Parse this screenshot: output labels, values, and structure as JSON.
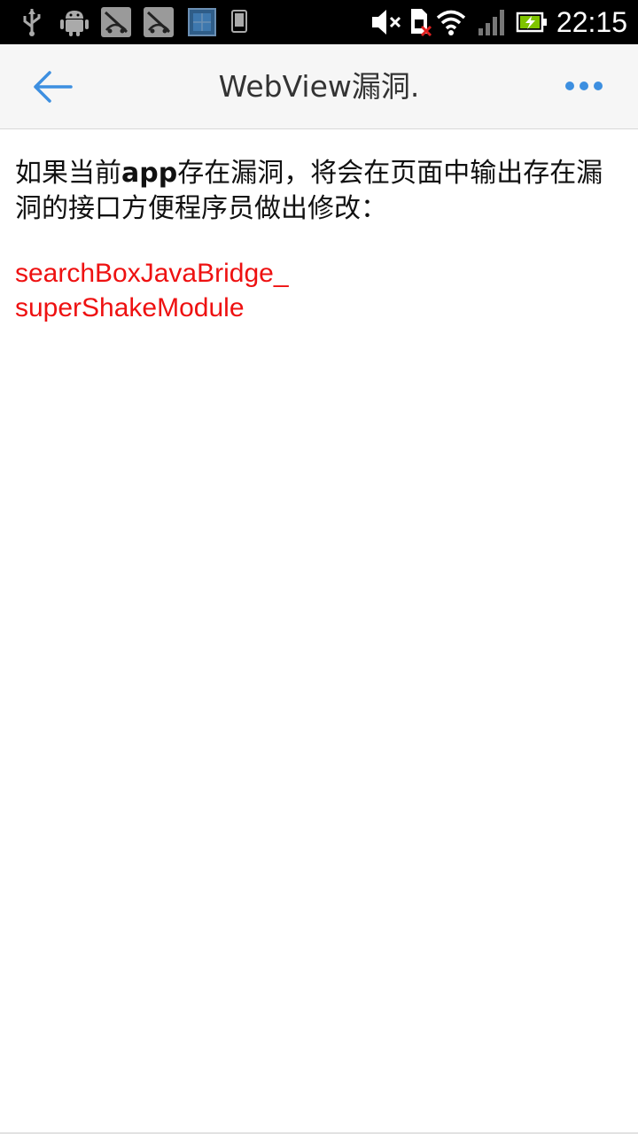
{
  "status_bar": {
    "time": "22:15",
    "icons": [
      "usb-icon",
      "android-debug-icon",
      "app-notification-icon",
      "app-notification-icon",
      "gallery-notification-icon",
      "phone-notification-icon",
      "mute-icon",
      "sim-error-icon",
      "wifi-icon",
      "signal-icon",
      "battery-charging-icon"
    ]
  },
  "title_bar": {
    "back_icon": "arrow-left-icon",
    "title": "WebView漏洞.",
    "more_icon": "more-dots-icon",
    "accent_color": "#3d8fe0"
  },
  "content": {
    "intro_part1": "如果当前",
    "intro_bold": "app",
    "intro_part2": "存在漏洞，将会在页面中输出存在漏洞的接口方便程序员做出修改：",
    "vulnerable_interfaces": [
      "searchBoxJavaBridge_",
      "superShakeModule"
    ],
    "interface_color": "#ee1111"
  }
}
